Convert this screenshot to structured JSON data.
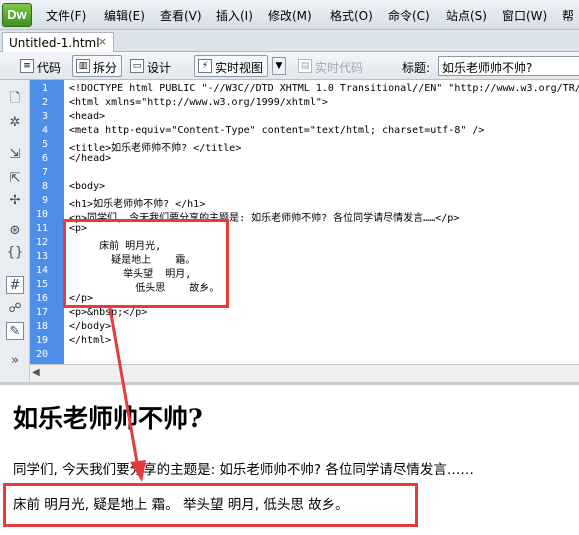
{
  "app": {
    "logo_text": "Dw"
  },
  "menu": [
    "文件(F)",
    "编辑(E)",
    "查看(V)",
    "插入(I)",
    "修改(M)",
    "格式(O)",
    "命令(C)",
    "站点(S)",
    "窗口(W)",
    "帮"
  ],
  "doc_tab": {
    "name": "Untitled-1.html",
    "close": "×"
  },
  "toolbar": {
    "code_label": "代码",
    "split_label": "拆分",
    "design_label": "设计",
    "live_view_label": "实时视图",
    "live_code_label": "实时代码",
    "title_label": "标题:",
    "title_value": "如乐老师帅不帅?"
  },
  "code_lines": [
    {
      "n": "1",
      "text": "<!DOCTYPE html PUBLIC \"-//W3C//DTD XHTML 1.0 Transitional//EN\" \"http://www.w3.org/TR/"
    },
    {
      "n": "2",
      "text": "<html xmlns=\"http://www.w3.org/1999/xhtml\">"
    },
    {
      "n": "3",
      "text": "<head>"
    },
    {
      "n": "4",
      "text": "<meta http-equiv=\"Content-Type\" content=\"text/html; charset=utf-8\" />"
    },
    {
      "n": "5",
      "text": "<title>如乐老师帅不帅? </title>"
    },
    {
      "n": "6",
      "text": "</head>"
    },
    {
      "n": "7",
      "text": ""
    },
    {
      "n": "8",
      "text": "<body>"
    },
    {
      "n": "9",
      "text": "<h1>如乐老师帅不帅? </h1>"
    },
    {
      "n": "10",
      "text": "<p>同学们, 今天我们要分享的主题是: 如乐老师帅不帅? 各位同学请尽情发言……</p>"
    },
    {
      "n": "11",
      "text": "<p>"
    },
    {
      "n": "12",
      "text": "     床前 明月光,"
    },
    {
      "n": "13",
      "text": "       疑是地上    霜。"
    },
    {
      "n": "14",
      "text": "         举头望  明月,"
    },
    {
      "n": "15",
      "text": "           低头思    故乡。"
    },
    {
      "n": "16",
      "text": "</p>"
    },
    {
      "n": "17",
      "text": "<p>&nbsp;</p>"
    },
    {
      "n": "18",
      "text": "</body>"
    },
    {
      "n": "19",
      "text": "</html>"
    },
    {
      "n": "20",
      "text": ""
    }
  ],
  "design": {
    "heading": "如乐老师帅不帅?",
    "paragraph1": "同学们, 今天我们要分享的主题是: 如乐老师帅不帅? 各位同学请尽情发言……",
    "paragraph2": "床前 明月光, 疑是地上 霜。 举头望 明月, 低头思 故乡。"
  },
  "colors": {
    "gutter": "#4d8fe8",
    "annotation": "#e63b3b"
  }
}
